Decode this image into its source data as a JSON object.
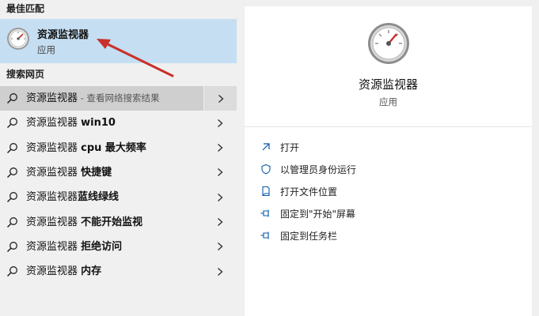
{
  "best_match": {
    "section_title": "最佳匹配",
    "name": "资源监视器",
    "type": "应用"
  },
  "web_search": {
    "section_title": "搜索网页",
    "rows": [
      {
        "prefix": "资源监视器",
        "bold": "",
        "sub": " - 查看网络搜索结果"
      },
      {
        "prefix": "资源监视器 ",
        "bold": "win10",
        "sub": ""
      },
      {
        "prefix": "资源监视器 ",
        "bold": "cpu 最大频率",
        "sub": ""
      },
      {
        "prefix": "资源监视器 ",
        "bold": "快捷键",
        "sub": ""
      },
      {
        "prefix": "资源监视器",
        "bold": "蓝线绿线",
        "sub": ""
      },
      {
        "prefix": "资源监视器 ",
        "bold": "不能开始监视",
        "sub": ""
      },
      {
        "prefix": "资源监视器 ",
        "bold": "拒绝访问",
        "sub": ""
      },
      {
        "prefix": "资源监视器 ",
        "bold": "内存",
        "sub": ""
      }
    ]
  },
  "detail": {
    "name": "资源监视器",
    "type": "应用",
    "actions": [
      {
        "label": "打开",
        "icon": "open-icon"
      },
      {
        "label": "以管理员身份运行",
        "icon": "shield-icon"
      },
      {
        "label": "打开文件位置",
        "icon": "file-location-icon"
      },
      {
        "label": "固定到\"开始\"屏幕",
        "icon": "pin-icon"
      },
      {
        "label": "固定到任务栏",
        "icon": "pin-icon"
      }
    ]
  },
  "colors": {
    "selected_bg": "#c5def2",
    "hover_bg": "#cfcfcf",
    "accent": "#0a5aa8",
    "annotation_arrow": "#c8302a"
  }
}
